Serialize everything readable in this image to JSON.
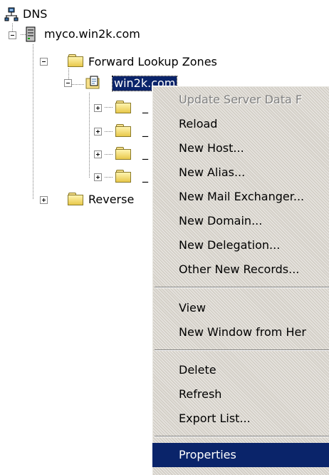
{
  "colors": {
    "selection": "#0a246a",
    "menu_bg": "#d4d0c8"
  },
  "tree": {
    "root": {
      "label": "DNS",
      "icon": "dns-network-icon"
    },
    "server": {
      "label": "myco.win2k.com",
      "icon": "server-tower-icon"
    },
    "forward_zones": {
      "label": "Forward Lookup Zones",
      "icon": "folder-icon"
    },
    "zone": {
      "label": "win2k.com",
      "icon": "zone-document-icon"
    },
    "subfolders": [
      {
        "label": "_",
        "icon": "folder-icon"
      },
      {
        "label": "_",
        "icon": "folder-icon"
      },
      {
        "label": "_",
        "icon": "folder-icon"
      },
      {
        "label": "_",
        "icon": "folder-icon"
      }
    ],
    "reverse_zones": {
      "label": "Reverse",
      "icon": "folder-icon"
    }
  },
  "context_menu": {
    "items": [
      {
        "label": "Update Server Data F",
        "disabled": true
      },
      {
        "label": "Reload"
      },
      {
        "label": "New Host..."
      },
      {
        "label": "New Alias..."
      },
      {
        "label": "New Mail Exchanger..."
      },
      {
        "label": "New Domain..."
      },
      {
        "label": "New Delegation..."
      },
      {
        "label": "Other New Records..."
      },
      {
        "label": "View"
      },
      {
        "label": "New Window from Her"
      },
      {
        "label": "Delete"
      },
      {
        "label": "Refresh"
      },
      {
        "label": "Export List..."
      },
      {
        "label": "Properties",
        "highlighted": true
      }
    ]
  }
}
